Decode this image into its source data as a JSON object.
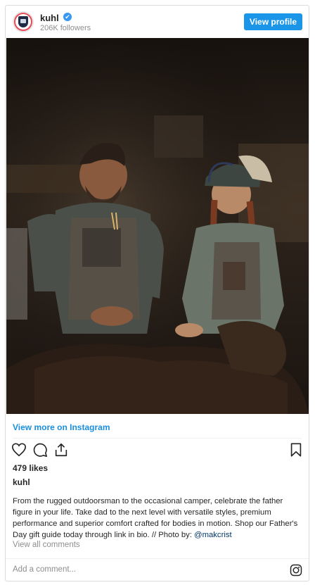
{
  "account": {
    "username": "kuhl",
    "followers": "206K followers",
    "verified_mark": "✔"
  },
  "header": {
    "view_profile_label": "View profile"
  },
  "links": {
    "view_more": "View more on Instagram"
  },
  "post": {
    "likes": "479 likes",
    "caption_username": "kuhl",
    "caption_text": "From the rugged outdoorsman to the occasional camper, celebrate the father figure in your life. Take dad to the next level with versatile styles, premium performance and superior comfort crafted for bodies in motion. Shop our Father's Day gift guide today through link in bio. // Photo by: ",
    "caption_mention": "@makcrist",
    "view_all_comments": "View all comments"
  },
  "comment_box": {
    "placeholder": "Add a comment..."
  },
  "colors": {
    "accent_blue": "#1a95e7",
    "link_blue": "#1a8fe0",
    "muted": "#8e8e8e"
  },
  "icons": [
    "heart-icon",
    "comment-icon",
    "share-icon",
    "bookmark-icon",
    "instagram-icon",
    "verified-icon"
  ]
}
